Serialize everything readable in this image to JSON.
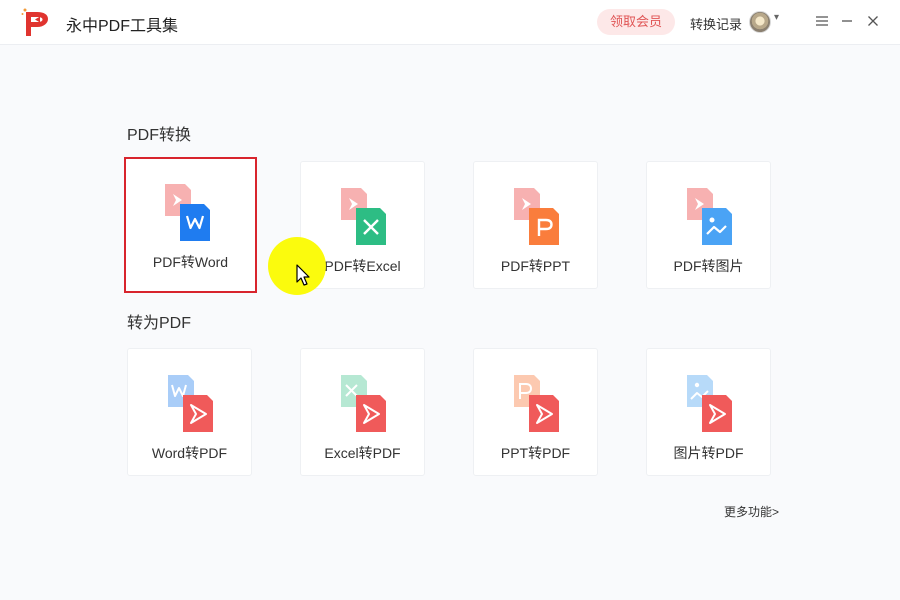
{
  "app": {
    "title": "永中PDF工具集"
  },
  "header": {
    "vip_label": "领取会员",
    "history_label": "转换记录",
    "avatar_caret": "▾"
  },
  "colors": {
    "accent_red": "#d8242d",
    "word_blue": "#1f7cf0",
    "excel_green": "#2dbd84",
    "ppt_orange": "#fa7d3c",
    "image_blue": "#4aa3f5",
    "pdf_red": "#f05a5a",
    "cursor_highlight": "#fbfb00"
  },
  "sections": [
    {
      "title": "PDF转换",
      "cards": [
        {
          "label": "PDF转Word",
          "icon": "pdf-to-word-icon",
          "selected": true
        },
        {
          "label": "PDF转Excel",
          "icon": "pdf-to-excel-icon",
          "selected": false
        },
        {
          "label": "PDF转PPT",
          "icon": "pdf-to-ppt-icon",
          "selected": false
        },
        {
          "label": "PDF转图片",
          "icon": "pdf-to-image-icon",
          "selected": false
        }
      ]
    },
    {
      "title": "转为PDF",
      "cards": [
        {
          "label": "Word转PDF",
          "icon": "word-to-pdf-icon"
        },
        {
          "label": "Excel转PDF",
          "icon": "excel-to-pdf-icon"
        },
        {
          "label": "PPT转PDF",
          "icon": "ppt-to-pdf-icon"
        },
        {
          "label": "图片转PDF",
          "icon": "image-to-pdf-icon"
        }
      ]
    }
  ],
  "more_label": "更多功能>"
}
